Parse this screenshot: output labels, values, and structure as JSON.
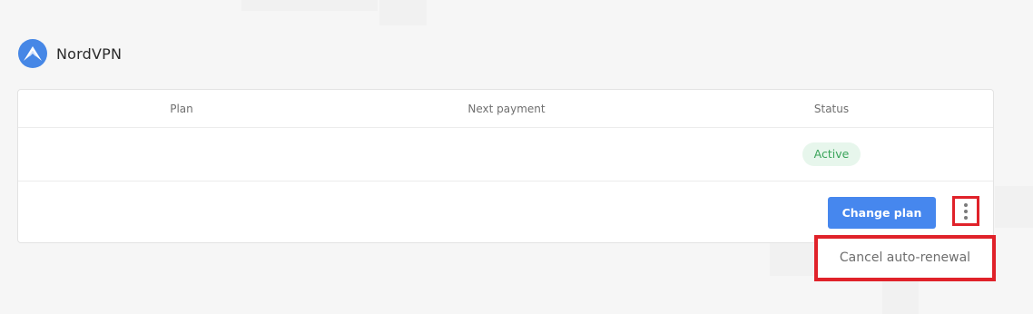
{
  "app": {
    "name": "NordVPN",
    "logo_icon": "nordvpn-mountain-logo",
    "brand_color": "#4687e6"
  },
  "table": {
    "headers": {
      "plan": "Plan",
      "next_payment": "Next payment",
      "status": "Status"
    },
    "row": {
      "plan": "",
      "next_payment": "",
      "status": "Active"
    }
  },
  "actions": {
    "change_plan_label": "Change plan",
    "more_icon": "vertical-ellipsis-icon",
    "menu_items": [
      {
        "label": "Cancel auto-renewal"
      }
    ]
  },
  "colors": {
    "primary_button": "#4687ee",
    "status_active_bg": "#e7f6ec",
    "status_active_text": "#3aa45a",
    "highlight": "#e0222a"
  }
}
